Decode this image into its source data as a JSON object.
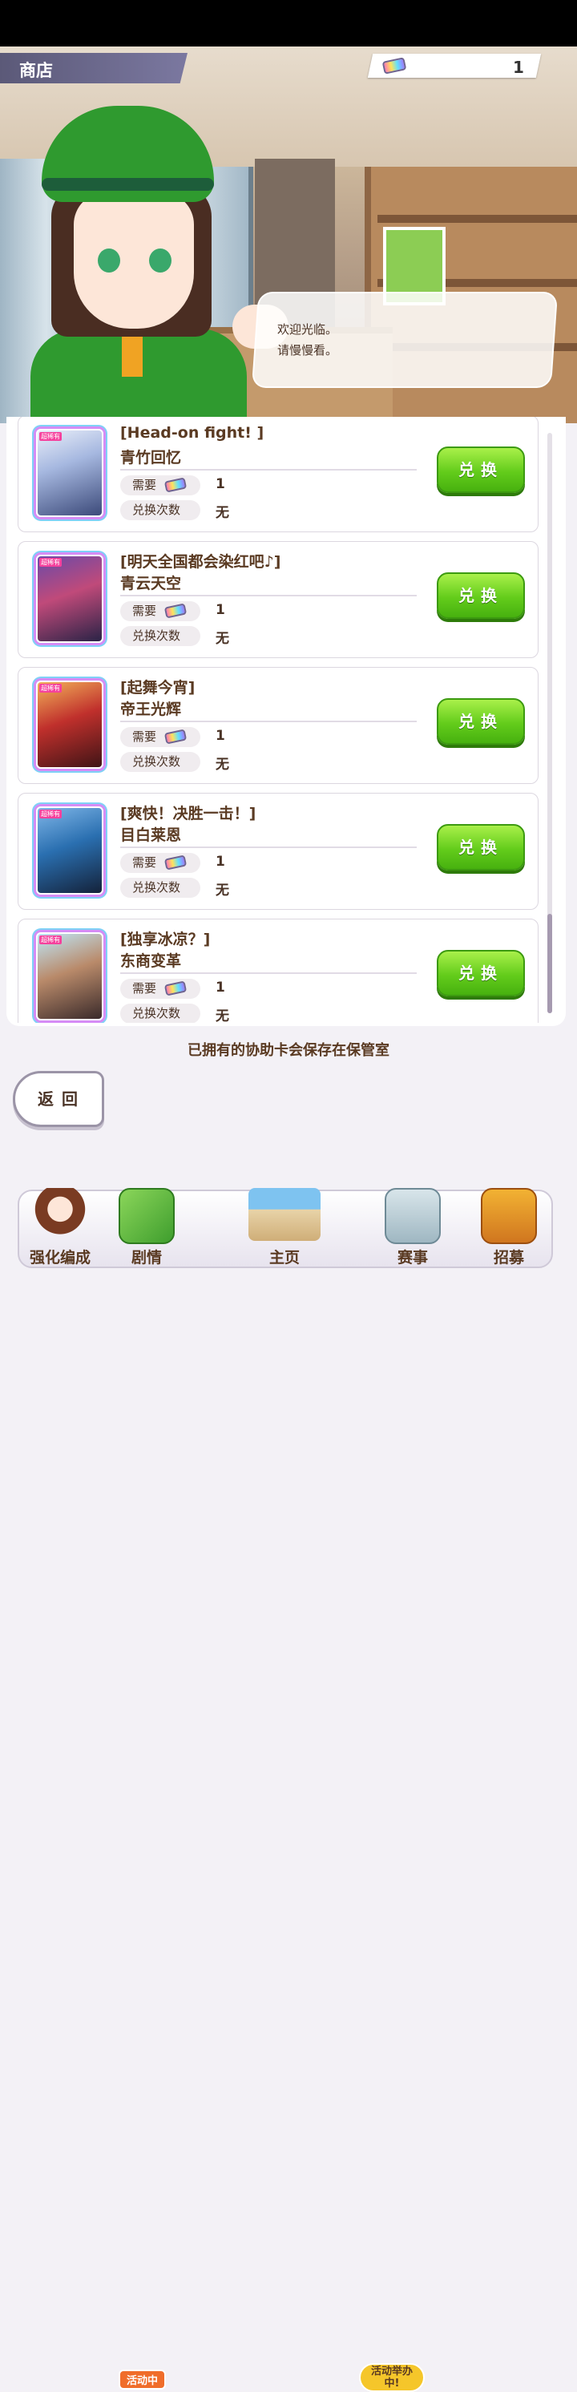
{
  "header": {
    "title": "商店",
    "currency_count": "1"
  },
  "dialog": {
    "lines": [
      "欢迎光临。",
      "请慢慢看。"
    ]
  },
  "labels": {
    "need": "需要",
    "exchange_count": "兑换次数",
    "exchange_button": "兑换",
    "card_badge": "超稀有"
  },
  "items": [
    {
      "title": "[Head-on fight! ]",
      "name": "青竹回忆",
      "cost": "1",
      "limit": "无"
    },
    {
      "title": "[明天全国都会染红吧♪]",
      "name": "青云天空",
      "cost": "1",
      "limit": "无"
    },
    {
      "title": "[起舞今宵]",
      "name": "帝王光辉",
      "cost": "1",
      "limit": "无"
    },
    {
      "title": "[爽快！决胜一击！]",
      "name": "目白莱恩",
      "cost": "1",
      "limit": "无"
    },
    {
      "title": "[独享冰凉？]",
      "name": "东商变革",
      "cost": "1",
      "limit": "无"
    }
  ],
  "footer_note": "已拥有的协助卡会保存在保管室",
  "back_button": "返回",
  "nav": {
    "items": [
      "强化编成",
      "剧情",
      "主页",
      "赛事",
      "招募"
    ],
    "story_badge": "活动中",
    "race_badge": "活动举办中!"
  },
  "colors": {
    "accent_green": "#63cc1b",
    "text_brown": "#5a3a22",
    "header_purple": "#6b6890"
  }
}
